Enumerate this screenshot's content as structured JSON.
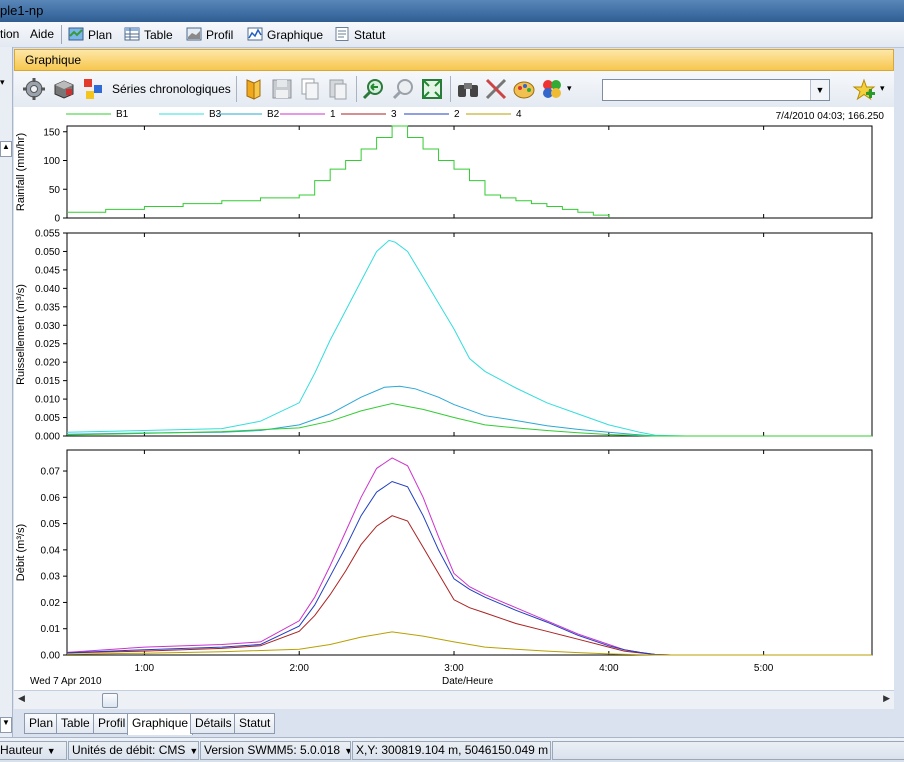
{
  "window": {
    "title": "ple1-np"
  },
  "menu": {
    "items": [
      {
        "label": "tion"
      },
      {
        "label": "Aide"
      },
      {
        "label": "Plan"
      },
      {
        "label": "Table"
      },
      {
        "label": "Profil"
      },
      {
        "label": "Graphique"
      },
      {
        "label": "Statut"
      }
    ]
  },
  "panel": {
    "title": "Graphique"
  },
  "toolbar": {
    "series_label": "Séries chronologiques",
    "combo_value": ""
  },
  "graph": {
    "timestamp": "7/4/2010 04:03; 166.250",
    "date_label": "Wed 7 Apr 2010",
    "xaxis_title": "Date/Heure"
  },
  "chart_data": [
    {
      "type": "line",
      "ylabel": "Rainfall (mm/hr)",
      "ylim": [
        0,
        160
      ],
      "yticks": [
        "0",
        "50",
        "100",
        "150"
      ],
      "xlim": [
        0.5,
        5.7
      ],
      "series": [
        {
          "name": "B1",
          "color": "#33cc33",
          "step": true,
          "x": [
            0.5,
            0.75,
            1.0,
            1.25,
            1.5,
            1.75,
            2.0,
            2.1,
            2.2,
            2.3,
            2.4,
            2.5,
            2.6,
            2.7,
            2.8,
            2.9,
            3.0,
            3.1,
            3.2,
            3.3,
            3.4,
            3.5,
            3.6,
            3.7,
            3.8,
            3.9,
            4.0
          ],
          "y": [
            10,
            15,
            20,
            25,
            30,
            35,
            40,
            65,
            85,
            100,
            120,
            140,
            160,
            140,
            120,
            100,
            85,
            65,
            40,
            35,
            30,
            25,
            20,
            15,
            10,
            5,
            0
          ]
        }
      ]
    },
    {
      "type": "line",
      "ylabel": "Ruissellement (m³/s)",
      "ylim": [
        0,
        0.055
      ],
      "yticks": [
        "0.000",
        "0.005",
        "0.010",
        "0.015",
        "0.020",
        "0.025",
        "0.030",
        "0.035",
        "0.040",
        "0.045",
        "0.050",
        "0.055"
      ],
      "xlim": [
        0.5,
        5.7
      ],
      "series": [
        {
          "name": "B3",
          "color": "#33dddd",
          "x": [
            0.5,
            1.0,
            1.5,
            1.75,
            2.0,
            2.1,
            2.2,
            2.3,
            2.4,
            2.5,
            2.58,
            2.62,
            2.7,
            2.8,
            2.9,
            3.0,
            3.1,
            3.2,
            3.4,
            3.6,
            3.8,
            4.0,
            4.2,
            4.3,
            4.5,
            5.0,
            5.5,
            5.7
          ],
          "y": [
            0.001,
            0.0015,
            0.002,
            0.004,
            0.009,
            0.017,
            0.026,
            0.034,
            0.042,
            0.05,
            0.053,
            0.0525,
            0.05,
            0.043,
            0.036,
            0.029,
            0.021,
            0.0175,
            0.013,
            0.009,
            0.006,
            0.003,
            0.001,
            0.0002,
            0,
            0,
            0,
            0
          ]
        },
        {
          "name": "B2",
          "color": "#2aa7d6",
          "x": [
            0.5,
            1.0,
            1.5,
            1.75,
            2.0,
            2.2,
            2.4,
            2.55,
            2.65,
            2.75,
            2.9,
            3.0,
            3.2,
            3.4,
            3.6,
            3.8,
            4.0,
            4.2,
            4.3,
            5.0,
            5.7
          ],
          "y": [
            0.0005,
            0.0008,
            0.001,
            0.0015,
            0.003,
            0.006,
            0.0105,
            0.0132,
            0.0135,
            0.0128,
            0.0105,
            0.0085,
            0.0055,
            0.0042,
            0.0028,
            0.0018,
            0.001,
            0.0003,
            0,
            0,
            0
          ]
        },
        {
          "name": "B1",
          "color": "#33cc33",
          "x": [
            0.5,
            1.0,
            1.5,
            2.0,
            2.2,
            2.4,
            2.6,
            2.8,
            3.0,
            3.2,
            3.4,
            3.6,
            3.8,
            4.0,
            4.2,
            4.3,
            5.0,
            5.7
          ],
          "y": [
            0.0003,
            0.0007,
            0.0012,
            0.0022,
            0.004,
            0.0068,
            0.0088,
            0.0072,
            0.005,
            0.003,
            0.0022,
            0.0015,
            0.0009,
            0.0004,
            0.0001,
            0,
            0,
            0
          ]
        }
      ]
    },
    {
      "type": "line",
      "ylabel": "Débit (m³/s)",
      "ylim": [
        0,
        0.078
      ],
      "yticks": [
        "0.00",
        "0.01",
        "0.02",
        "0.03",
        "0.04",
        "0.05",
        "0.06",
        "0.07"
      ],
      "xlim": [
        0.5,
        5.7
      ],
      "series": [
        {
          "name": "1",
          "color": "#cc33cc",
          "x": [
            0.5,
            1.0,
            1.5,
            1.75,
            2.0,
            2.1,
            2.2,
            2.3,
            2.4,
            2.5,
            2.6,
            2.7,
            2.8,
            2.9,
            3.0,
            3.1,
            3.2,
            3.4,
            3.6,
            3.8,
            4.0,
            4.1,
            4.2,
            4.3,
            4.4,
            5.0,
            5.7
          ],
          "y": [
            0.001,
            0.003,
            0.004,
            0.005,
            0.013,
            0.022,
            0.034,
            0.047,
            0.06,
            0.071,
            0.075,
            0.072,
            0.06,
            0.045,
            0.031,
            0.026,
            0.023,
            0.018,
            0.013,
            0.008,
            0.004,
            0.002,
            0.001,
            0.0002,
            0,
            0,
            0
          ]
        },
        {
          "name": "3",
          "color": "#aa2222",
          "x": [
            0.5,
            1.0,
            1.5,
            1.75,
            2.0,
            2.1,
            2.2,
            2.3,
            2.4,
            2.5,
            2.6,
            2.7,
            2.8,
            2.9,
            3.0,
            3.1,
            3.2,
            3.4,
            3.6,
            3.8,
            4.0,
            4.1,
            4.2,
            4.3,
            4.4,
            5.0,
            5.7
          ],
          "y": [
            0.0008,
            0.0015,
            0.0025,
            0.0035,
            0.009,
            0.015,
            0.023,
            0.032,
            0.042,
            0.049,
            0.053,
            0.051,
            0.041,
            0.031,
            0.021,
            0.018,
            0.016,
            0.012,
            0.009,
            0.006,
            0.003,
            0.0015,
            0.0008,
            0.0002,
            0,
            0,
            0
          ]
        },
        {
          "name": "2",
          "color": "#1f3fbf",
          "x": [
            0.5,
            1.0,
            1.5,
            1.75,
            2.0,
            2.1,
            2.2,
            2.3,
            2.4,
            2.5,
            2.6,
            2.7,
            2.8,
            2.9,
            3.0,
            3.1,
            3.2,
            3.4,
            3.6,
            3.8,
            4.0,
            4.1,
            4.2,
            4.3,
            4.4,
            5.0,
            5.7
          ],
          "y": [
            0.0008,
            0.002,
            0.003,
            0.004,
            0.011,
            0.019,
            0.03,
            0.041,
            0.053,
            0.062,
            0.066,
            0.064,
            0.053,
            0.04,
            0.029,
            0.025,
            0.022,
            0.017,
            0.0125,
            0.0075,
            0.0035,
            0.002,
            0.001,
            0.0002,
            0,
            0,
            0
          ]
        },
        {
          "name": "4",
          "color": "#b8a000",
          "x": [
            0.5,
            1.0,
            1.5,
            2.0,
            2.2,
            2.4,
            2.6,
            2.8,
            3.0,
            3.2,
            3.4,
            3.6,
            3.8,
            4.0,
            4.2,
            4.3,
            5.0,
            5.7
          ],
          "y": [
            0.0003,
            0.0007,
            0.0012,
            0.0022,
            0.004,
            0.0068,
            0.0088,
            0.0072,
            0.005,
            0.003,
            0.0022,
            0.0015,
            0.0009,
            0.0004,
            0.0001,
            0,
            0,
            0
          ]
        }
      ]
    }
  ],
  "legend": [
    {
      "name": "B1",
      "color": "#33cc33"
    },
    {
      "name": "B3",
      "color": "#33dddd"
    },
    {
      "name": "B2",
      "color": "#2aa7d6"
    },
    {
      "name": "1",
      "color": "#cc33cc"
    },
    {
      "name": "3",
      "color": "#aa2222"
    },
    {
      "name": "2",
      "color": "#1f3fbf"
    },
    {
      "name": "4",
      "color": "#b8a000"
    }
  ],
  "xticks": [
    "1:00",
    "2:00",
    "3:00",
    "4:00",
    "5:00"
  ],
  "tabs": [
    {
      "label": "Plan"
    },
    {
      "label": "Table"
    },
    {
      "label": "Profil"
    },
    {
      "label": "Graphique"
    },
    {
      "label": "Détails"
    },
    {
      "label": "Statut"
    }
  ],
  "status": {
    "height_unit": "Hauteur",
    "flow_units": "Unités de débit: CMS",
    "version": "Version SWMM5: 5.0.018",
    "coords": "X,Y: 300819.104 m, 5046150.049 m"
  }
}
